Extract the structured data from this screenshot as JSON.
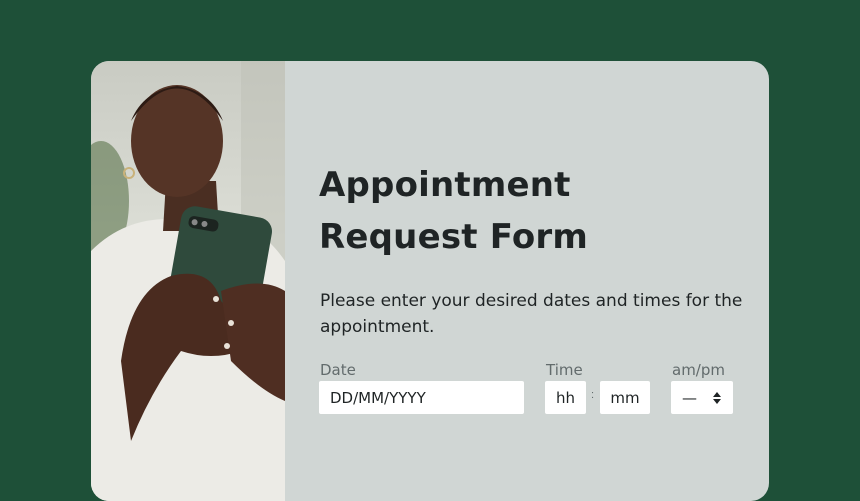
{
  "form": {
    "title_line1": "Appointment",
    "title_line2": "Request Form",
    "description": "Please enter your desired dates and times for the appointment.",
    "date": {
      "label": "Date",
      "placeholder": "DD/MM/YYYY",
      "icon": "calendar-icon"
    },
    "time": {
      "label": "Time",
      "hour_placeholder": "hh",
      "separator": ":",
      "minute_placeholder": "mm"
    },
    "ampm": {
      "label": "am/pm",
      "value": "—",
      "icon": "sort-arrows-icon"
    }
  },
  "colors": {
    "background": "#1e5038",
    "card": "#d0d6d4",
    "text": "#1f2425",
    "label": "#626b6c"
  }
}
